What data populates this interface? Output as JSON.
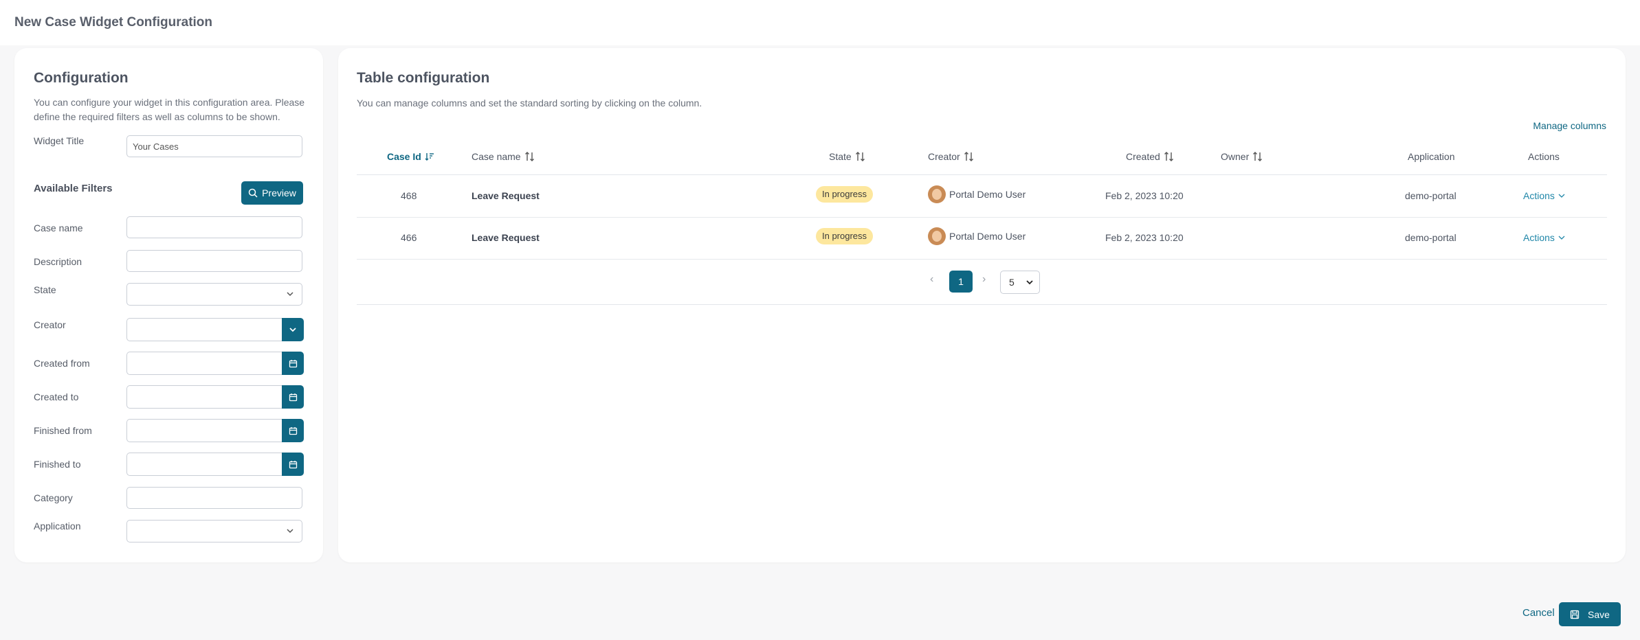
{
  "page": {
    "title": "New Case Widget Configuration"
  },
  "config": {
    "title": "Configuration",
    "description": "You can configure your widget in this configuration area. Please define the required filters as well as columns to be shown.",
    "widget_title_label": "Widget Title",
    "widget_title_value": "Your Cases",
    "filters_heading": "Available Filters",
    "preview_label": "Preview",
    "filters": {
      "case_name": "Case name",
      "description": "Description",
      "state": "State",
      "creator": "Creator",
      "created_from": "Created from",
      "created_to": "Created to",
      "finished_from": "Finished from",
      "finished_to": "Finished to",
      "category": "Category",
      "application": "Application"
    }
  },
  "table": {
    "title": "Table configuration",
    "description": "You can manage columns and set the standard sorting by clicking on the column.",
    "manage_columns": "Manage columns",
    "columns": {
      "case_id": "Case Id",
      "case_name": "Case name",
      "state": "State",
      "creator": "Creator",
      "created": "Created",
      "owner": "Owner",
      "application": "Application",
      "actions": "Actions"
    },
    "rows": [
      {
        "id": "468",
        "name": "Leave Request",
        "state": "In progress",
        "creator": "Portal Demo User",
        "created": "Feb 2, 2023 10:20",
        "owner": "",
        "application": "demo-portal",
        "actions": "Actions"
      },
      {
        "id": "466",
        "name": "Leave Request",
        "state": "In progress",
        "creator": "Portal Demo User",
        "created": "Feb 2, 2023 10:20",
        "owner": "",
        "application": "demo-portal",
        "actions": "Actions"
      }
    ],
    "pagination": {
      "current_page": "1",
      "page_size": "5"
    }
  },
  "footer": {
    "cancel": "Cancel",
    "save": "Save"
  },
  "colors": {
    "primary": "#0f6783",
    "badge_in_progress": "#fde79e"
  }
}
